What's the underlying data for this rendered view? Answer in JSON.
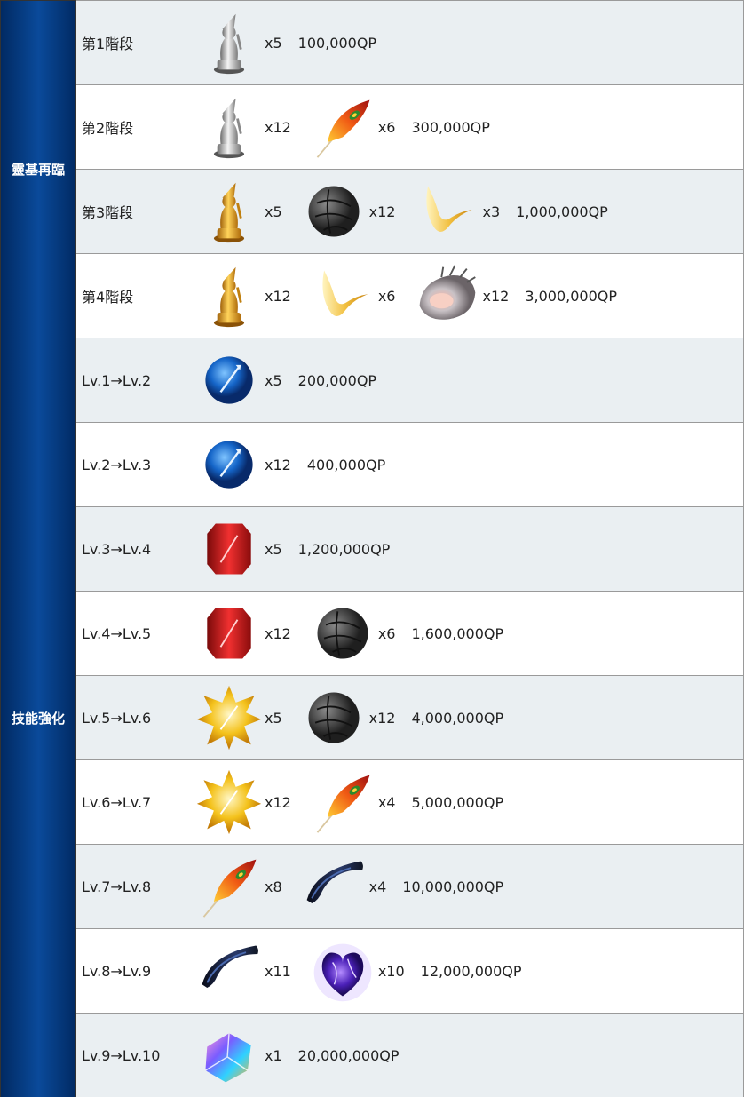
{
  "groups": {
    "ascension": "靈基再臨",
    "skill": "技能強化"
  },
  "ascension_rows": [
    {
      "stage": "第1階段",
      "materials": [
        {
          "icon": "silver-statue-icon",
          "qty": "x5"
        }
      ],
      "qp": "100,000QP"
    },
    {
      "stage": "第2階段",
      "materials": [
        {
          "icon": "silver-statue-icon",
          "qty": "x12"
        },
        {
          "icon": "phoenix-feather-icon",
          "qty": "x6"
        }
      ],
      "qp": "300,000QP"
    },
    {
      "stage": "第3階段",
      "materials": [
        {
          "icon": "gold-statue-icon",
          "qty": "x5"
        },
        {
          "icon": "black-rock-icon",
          "qty": "x12"
        },
        {
          "icon": "golden-fang-icon",
          "qty": "x3"
        }
      ],
      "qp": "1,000,000QP"
    },
    {
      "stage": "第4階段",
      "materials": [
        {
          "icon": "gold-statue-icon",
          "qty": "x12"
        },
        {
          "icon": "golden-fang-icon",
          "qty": "x6"
        },
        {
          "icon": "spiral-shell-icon",
          "qty": "x12"
        }
      ],
      "qp": "3,000,000QP"
    }
  ],
  "skill_rows": [
    {
      "stage": "Lv.1→Lv.2",
      "materials": [
        {
          "icon": "blue-gem-icon",
          "qty": "x5"
        }
      ],
      "qp": "200,000QP"
    },
    {
      "stage": "Lv.2→Lv.3",
      "materials": [
        {
          "icon": "blue-gem-icon",
          "qty": "x12"
        }
      ],
      "qp": "400,000QP"
    },
    {
      "stage": "Lv.3→Lv.4",
      "materials": [
        {
          "icon": "red-gem-icon",
          "qty": "x5"
        }
      ],
      "qp": "1,200,000QP"
    },
    {
      "stage": "Lv.4→Lv.5",
      "materials": [
        {
          "icon": "red-gem-icon",
          "qty": "x12"
        },
        {
          "icon": "black-rock-icon",
          "qty": "x6"
        }
      ],
      "qp": "1,600,000QP"
    },
    {
      "stage": "Lv.5→Lv.6",
      "materials": [
        {
          "icon": "gold-star-gem-icon",
          "qty": "x5"
        },
        {
          "icon": "black-rock-icon",
          "qty": "x12"
        }
      ],
      "qp": "4,000,000QP"
    },
    {
      "stage": "Lv.6→Lv.7",
      "materials": [
        {
          "icon": "gold-star-gem-icon",
          "qty": "x12"
        },
        {
          "icon": "phoenix-feather-icon",
          "qty": "x4"
        }
      ],
      "qp": "5,000,000QP"
    },
    {
      "stage": "Lv.7→Lv.8",
      "materials": [
        {
          "icon": "phoenix-feather-icon",
          "qty": "x8"
        },
        {
          "icon": "black-claw-icon",
          "qty": "x4"
        }
      ],
      "qp": "10,000,000QP"
    },
    {
      "stage": "Lv.8→Lv.9",
      "materials": [
        {
          "icon": "black-claw-icon",
          "qty": "x11"
        },
        {
          "icon": "purple-heart-icon",
          "qty": "x10"
        }
      ],
      "qp": "12,000,000QP"
    },
    {
      "stage": "Lv.9→Lv.10",
      "materials": [
        {
          "icon": "rainbow-crystal-icon",
          "qty": "x1"
        }
      ],
      "qp": "20,000,000QP"
    }
  ]
}
